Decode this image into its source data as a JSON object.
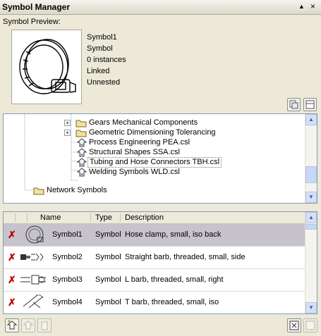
{
  "window": {
    "title": "Symbol Manager",
    "pin_glyph": "▲",
    "close_glyph": "×"
  },
  "preview": {
    "label": "Symbol Preview:",
    "info": [
      "Symbol1",
      "Symbol",
      "0 instances",
      "Linked",
      "Unnested"
    ]
  },
  "tree": {
    "items": [
      {
        "label": "Gears Mechanical Components",
        "expander": "+",
        "icon": "folder-icon"
      },
      {
        "label": "Geometric Dimensioning Tolerancing",
        "expander": "+",
        "icon": "folder-icon"
      },
      {
        "label": "Process Engineering PEA.csl",
        "icon": "library-link-icon"
      },
      {
        "label": "Structural Shapes SSA.csl",
        "icon": "library-link-icon"
      },
      {
        "label": "Tubing and Hose Connectors TBH.csl",
        "icon": "library-link-icon"
      },
      {
        "label": "Welding Symbols WLD.csl",
        "icon": "library-link-icon"
      },
      {
        "label": "Network Symbols",
        "icon": "folder-icon"
      }
    ]
  },
  "grid": {
    "columns": [
      "Name",
      "Type",
      "Description"
    ],
    "rows": [
      {
        "name": "Symbol1",
        "type": "Symbol",
        "description": "Hose clamp, small, iso back",
        "selected": true
      },
      {
        "name": "Symbol2",
        "type": "Symbol",
        "description": "Straight barb, threaded, small, side"
      },
      {
        "name": "Symbol3",
        "type": "Symbol",
        "description": "L barb, threaded, small, right"
      },
      {
        "name": "Symbol4",
        "type": "Symbol",
        "description": "T barb, threaded, small, iso"
      }
    ]
  },
  "colors": {
    "selection": "#c6c3cc",
    "border": "#7f9db9",
    "panel": "#ece9d8",
    "delete_mark": "#c00000"
  }
}
